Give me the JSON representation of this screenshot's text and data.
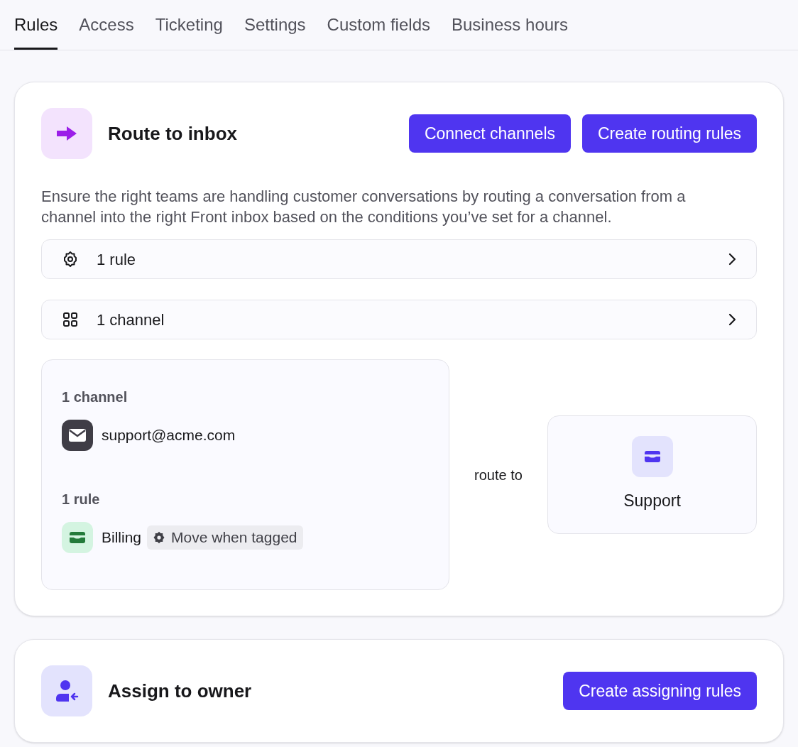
{
  "tabs": [
    {
      "label": "Rules",
      "selected": true
    },
    {
      "label": "Access",
      "selected": false
    },
    {
      "label": "Ticketing",
      "selected": false
    },
    {
      "label": "Settings",
      "selected": false
    },
    {
      "label": "Custom fields",
      "selected": false
    },
    {
      "label": "Business hours",
      "selected": false
    }
  ],
  "sections": [
    {
      "kind": "route",
      "title": "Route to inbox",
      "buttons": [
        "Connect channels",
        "Create routing rules"
      ],
      "description": "Ensure the right teams are handling customer conversations by routing a conversation from a channel into the right Front inbox based on the conditions you’ve set for a channel.",
      "summary_rows": [
        {
          "kind": "rules",
          "label": "1 rule"
        },
        {
          "kind": "channels",
          "label": "1 channel"
        }
      ],
      "diagram": {
        "channels_heading": "1 channel",
        "channel": "support@acme.com",
        "rules_heading": "1 rule",
        "rule_inbox": "Billing",
        "rule_tag": "Move when tagged",
        "connector": "route to",
        "target_inbox": "Support"
      }
    },
    {
      "kind": "assign",
      "title": "Assign to owner",
      "buttons": [
        "Create assigning rules"
      ]
    }
  ]
}
